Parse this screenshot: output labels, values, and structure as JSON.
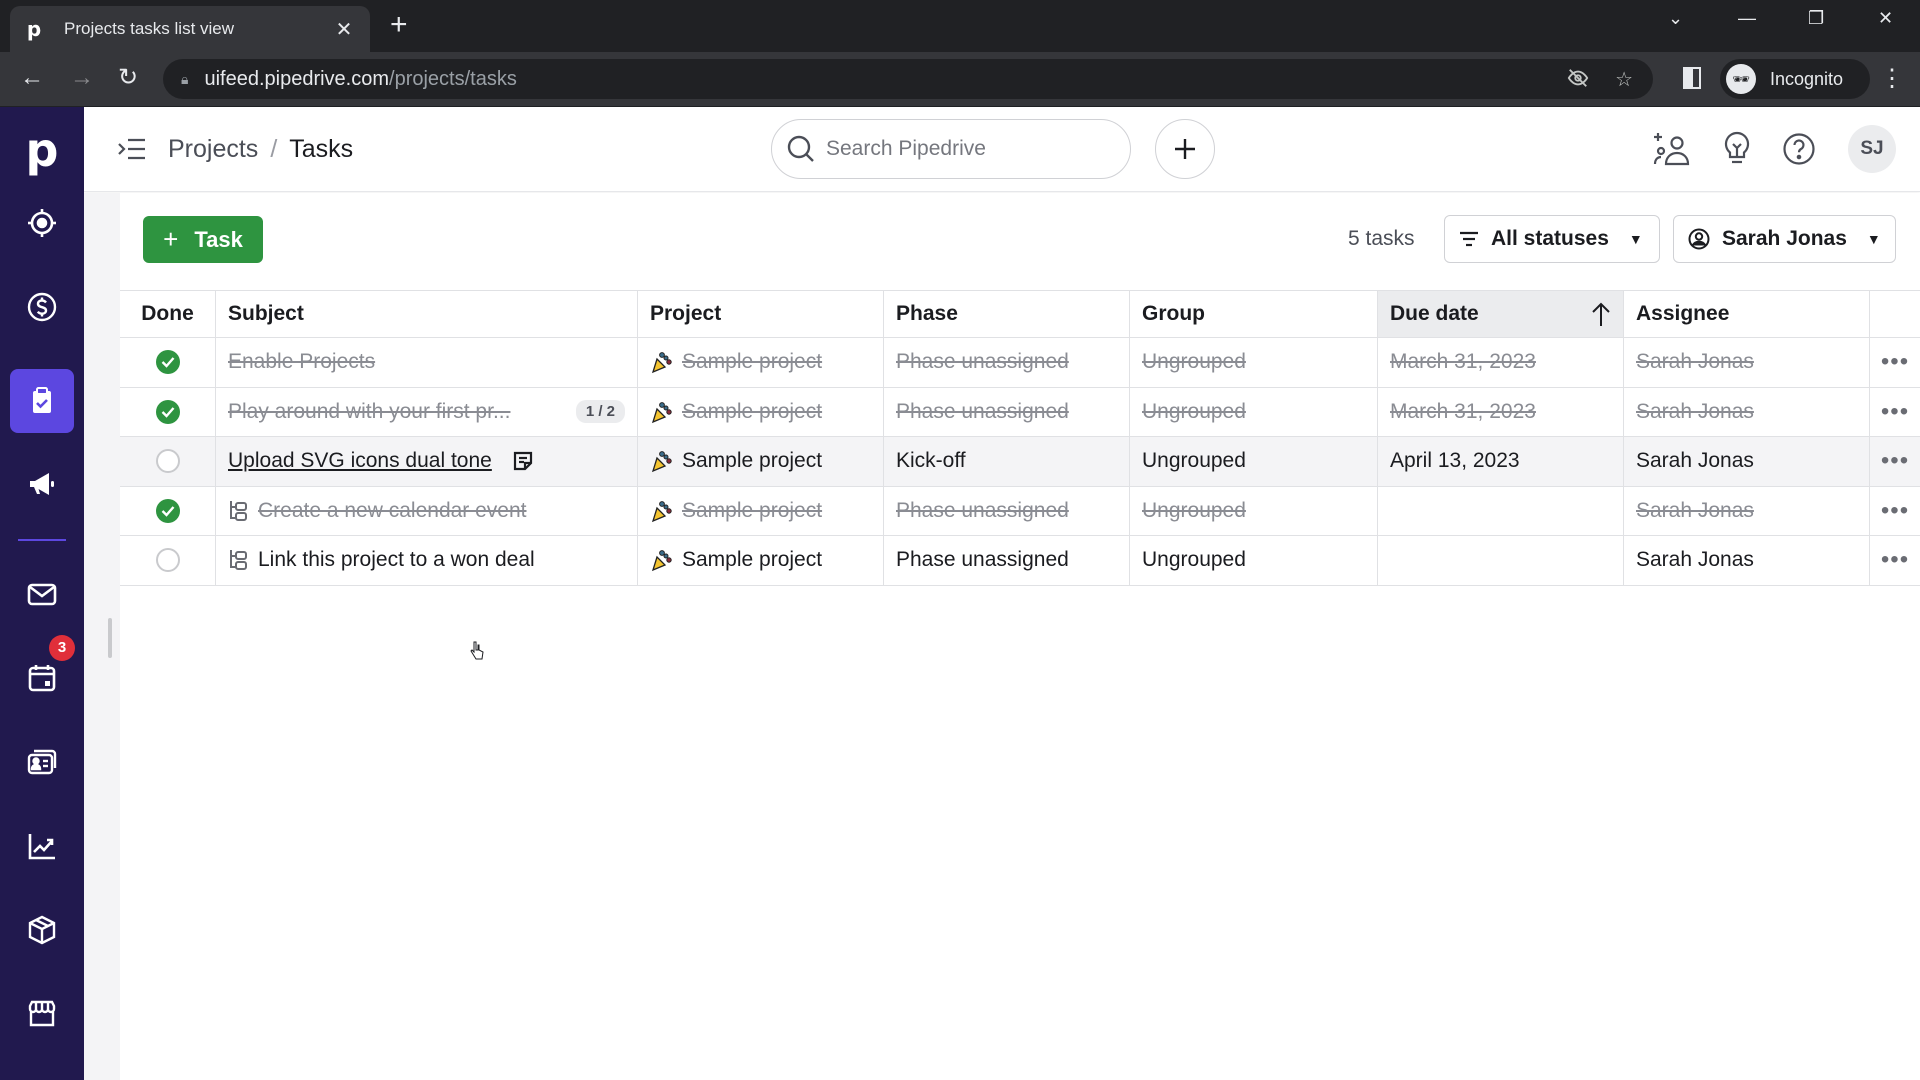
{
  "browser": {
    "tab_title": "Projects tasks list view",
    "tab_favicon": "p",
    "url_host": "uifeed.pipedrive.com",
    "url_path": "/projects/tasks",
    "profile_label": "Incognito"
  },
  "sidebar": {
    "logo": "p",
    "items": [
      {
        "name": "leads",
        "icon": "target-icon"
      },
      {
        "name": "deals",
        "icon": "dollar-icon"
      },
      {
        "name": "projects",
        "icon": "clipboard-check-icon",
        "active": true
      },
      {
        "name": "campaigns",
        "icon": "megaphone-icon"
      },
      {
        "name": "mail",
        "icon": "mail-icon"
      },
      {
        "name": "activities",
        "icon": "calendar-icon",
        "badge": "3"
      },
      {
        "name": "contacts",
        "icon": "contact-card-icon"
      },
      {
        "name": "insights",
        "icon": "chart-trend-icon"
      },
      {
        "name": "products",
        "icon": "box-icon"
      },
      {
        "name": "marketplace",
        "icon": "store-icon"
      }
    ]
  },
  "header": {
    "breadcrumb_parent": "Projects",
    "breadcrumb_sep": "/",
    "breadcrumb_current": "Tasks",
    "search_placeholder": "Search Pipedrive",
    "avatar_initials": "SJ"
  },
  "toolbar": {
    "add_task_label": "Task",
    "task_count": "5 tasks",
    "status_filter": "All statuses",
    "assignee_filter": "Sarah Jonas"
  },
  "table": {
    "columns": [
      "Done",
      "Subject",
      "Project",
      "Phase",
      "Group",
      "Due date",
      "Assignee"
    ],
    "sorted_column": "Due date",
    "sort_direction": "ascending",
    "rows": [
      {
        "done": true,
        "subject": "Enable Projects",
        "subtasks": "",
        "is_subtask": false,
        "has_note": false,
        "project": "Sample project",
        "phase": "Phase unassigned",
        "group": "Ungrouped",
        "due": "March 31, 2023",
        "assignee": "Sarah Jonas"
      },
      {
        "done": true,
        "subject": "Play around with your first pr...",
        "subtasks": "1 / 2",
        "is_subtask": false,
        "has_note": false,
        "project": "Sample project",
        "phase": "Phase unassigned",
        "group": "Ungrouped",
        "due": "March 31, 2023",
        "assignee": "Sarah Jonas"
      },
      {
        "done": false,
        "subject": "Upload SVG icons dual tone",
        "subtasks": "",
        "is_subtask": false,
        "has_note": true,
        "project": "Sample project",
        "phase": "Kick-off",
        "group": "Ungrouped",
        "due": "April 13, 2023",
        "assignee": "Sarah Jonas"
      },
      {
        "done": true,
        "subject": "Create a new calendar event",
        "subtasks": "",
        "is_subtask": true,
        "has_note": false,
        "project": "Sample project",
        "phase": "Phase unassigned",
        "group": "Ungrouped",
        "due": "",
        "assignee": "Sarah Jonas"
      },
      {
        "done": false,
        "subject": "Link this project to a won deal",
        "subtasks": "",
        "is_subtask": true,
        "has_note": false,
        "project": "Sample project",
        "phase": "Phase unassigned",
        "group": "Ungrouped",
        "due": "",
        "assignee": "Sarah Jonas"
      }
    ]
  },
  "colors": {
    "sidebar_bg": "#21194e",
    "sidebar_active": "#5c47e0",
    "primary_green": "#2e9440",
    "badge_red": "#e02f3a"
  }
}
